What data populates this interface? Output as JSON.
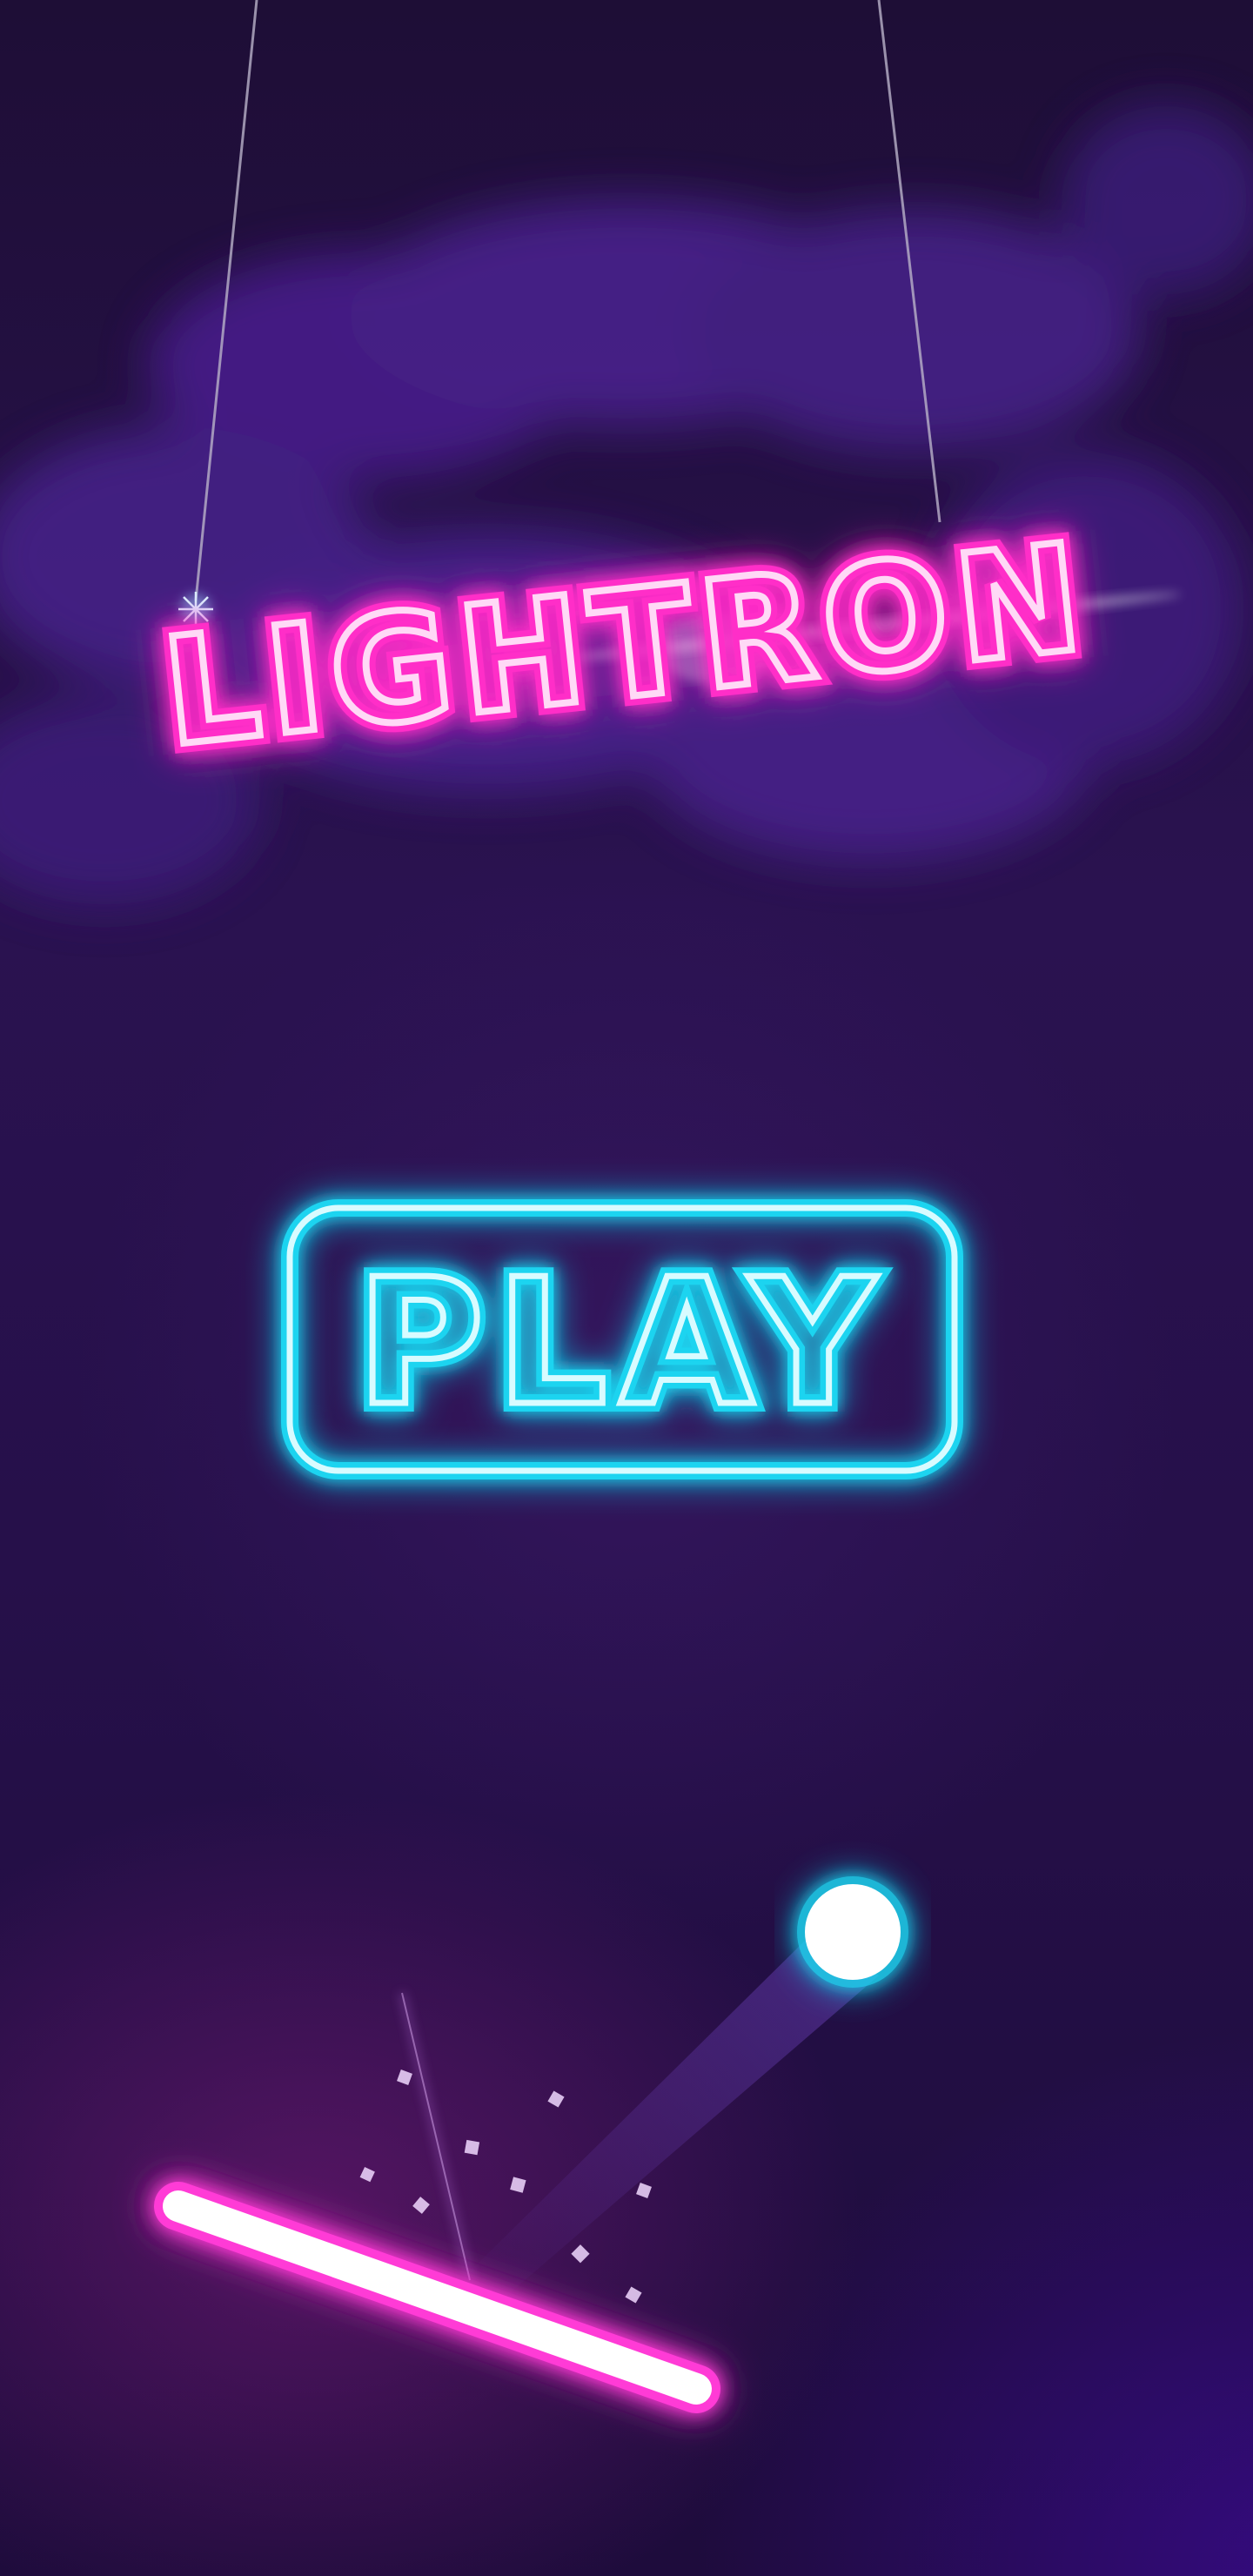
{
  "game": {
    "title": "LIGHTRON",
    "play_label": "PLAY"
  },
  "colors": {
    "background": "#1e0f3a",
    "title_neon": "#ff2fc8",
    "play_neon": "#1fd4f0",
    "paddle_neon": "#ff3bd6",
    "ball_glow": "#1fd4f0"
  },
  "icons": {
    "ball": "neon-ball-icon",
    "paddle": "neon-paddle-icon"
  }
}
